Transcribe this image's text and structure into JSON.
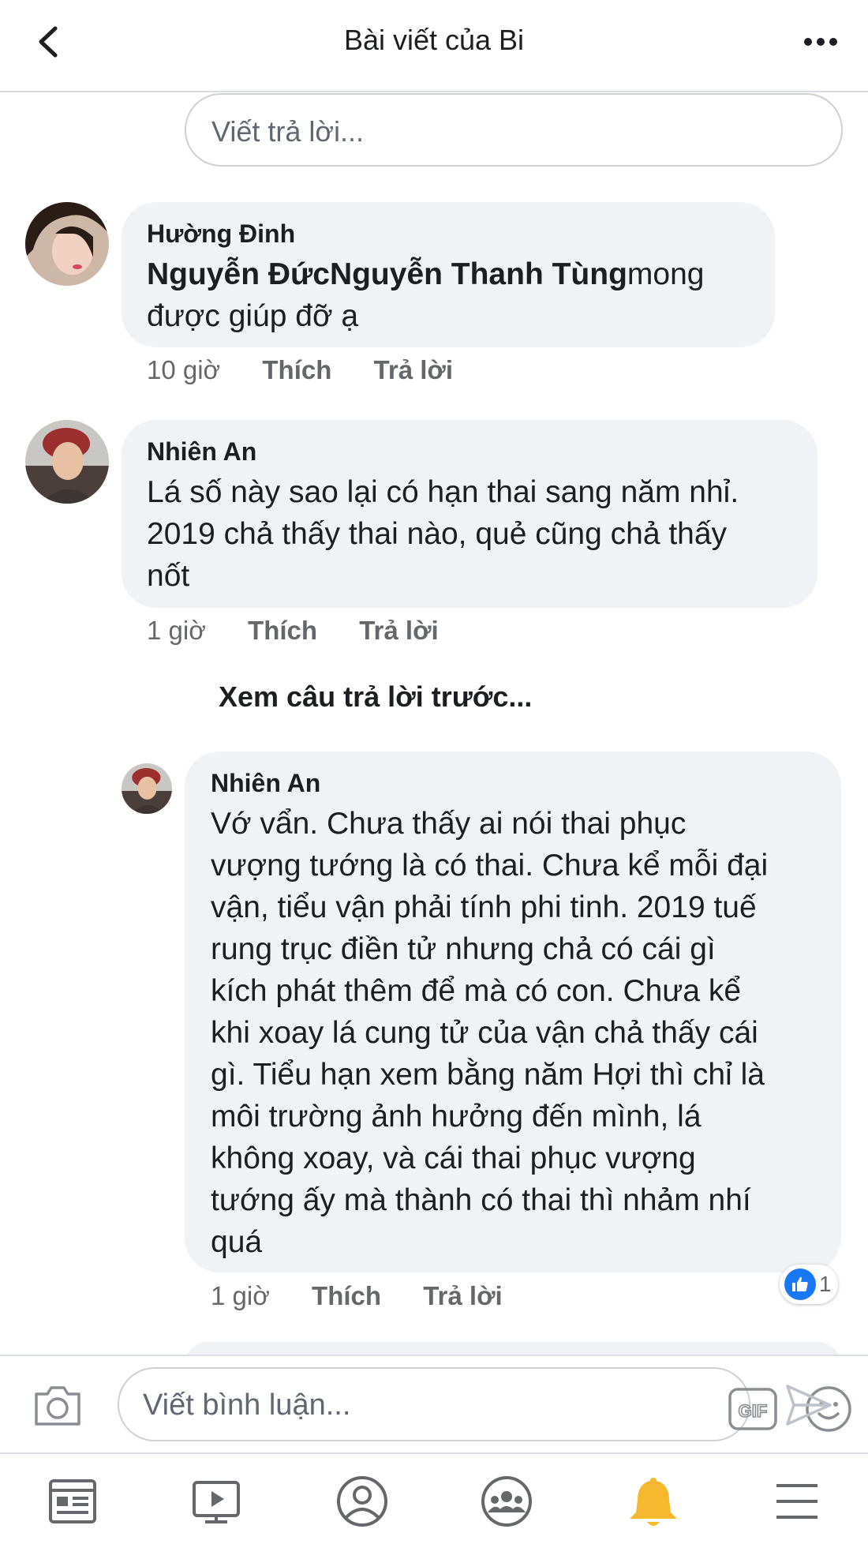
{
  "header": {
    "title": "Bài viết của Bi",
    "back_icon": "chevron-left-icon",
    "more_icon": "more-horizontal-icon"
  },
  "reply_box": {
    "placeholder": "Viết trả lời..."
  },
  "comments": [
    {
      "author": "Hường Đinh",
      "mention": "Nguyễn ĐứcNguyễn Thanh Tùng",
      "text_rest": "mong",
      "text_line2": "được giúp đỡ ạ",
      "time": "10 giờ",
      "like_label": "Thích",
      "reply_label": "Trả lời"
    },
    {
      "author": "Nhiên An",
      "lines": [
        "Lá số này sao lại có hạn thai sang năm nhỉ.",
        "2019 chả thấy thai nào, quẻ cũng chả thấy",
        "nốt"
      ],
      "time": "1 giờ",
      "like_label": "Thích",
      "reply_label": "Trả lời"
    }
  ],
  "view_previous": "Xem câu trả lời trước...",
  "reply": {
    "author": "Nhiên An",
    "lines": [
      "Vớ vẩn. Chưa thấy ai nói thai phục",
      "vượng tướng là có thai. Chưa kể mỗi đại",
      "vận, tiểu vận phải tính phi tinh. 2019 tuế",
      "rung trục điền tử nhưng chả có cái gì",
      "kích phát thêm để mà có con. Chưa kể",
      "khi xoay lá cung tử của vận chả thấy cái",
      "gì. Tiểu hạn xem bằng năm Hợi thì chỉ là",
      "môi trường ảnh hưởng đến mình, lá",
      "không xoay, và cái thai phục vượng",
      "tướng ấy mà thành có thai thì nhảm nhí",
      "quá"
    ],
    "time": "1 giờ",
    "like_label": "Thích",
    "reply_label": "Trả lời",
    "reaction_icon": "like-icon",
    "reaction_count": "1"
  },
  "composer": {
    "placeholder": "Viết bình luận...",
    "gif_label": "GIF",
    "camera_icon": "camera-icon",
    "emoji_icon": "smiley-icon",
    "send_icon": "send-icon"
  },
  "bottom_nav": [
    {
      "icon": "news-feed-icon"
    },
    {
      "icon": "watch-video-icon"
    },
    {
      "icon": "profile-icon"
    },
    {
      "icon": "groups-icon"
    },
    {
      "icon": "notifications-bell-icon",
      "active_color": "#f5b82e"
    },
    {
      "icon": "menu-icon"
    }
  ],
  "colors": {
    "accent": "#1877f2",
    "bubble": "#f0f2f5",
    "muted": "#65676b",
    "bell": "#f5b82e"
  }
}
